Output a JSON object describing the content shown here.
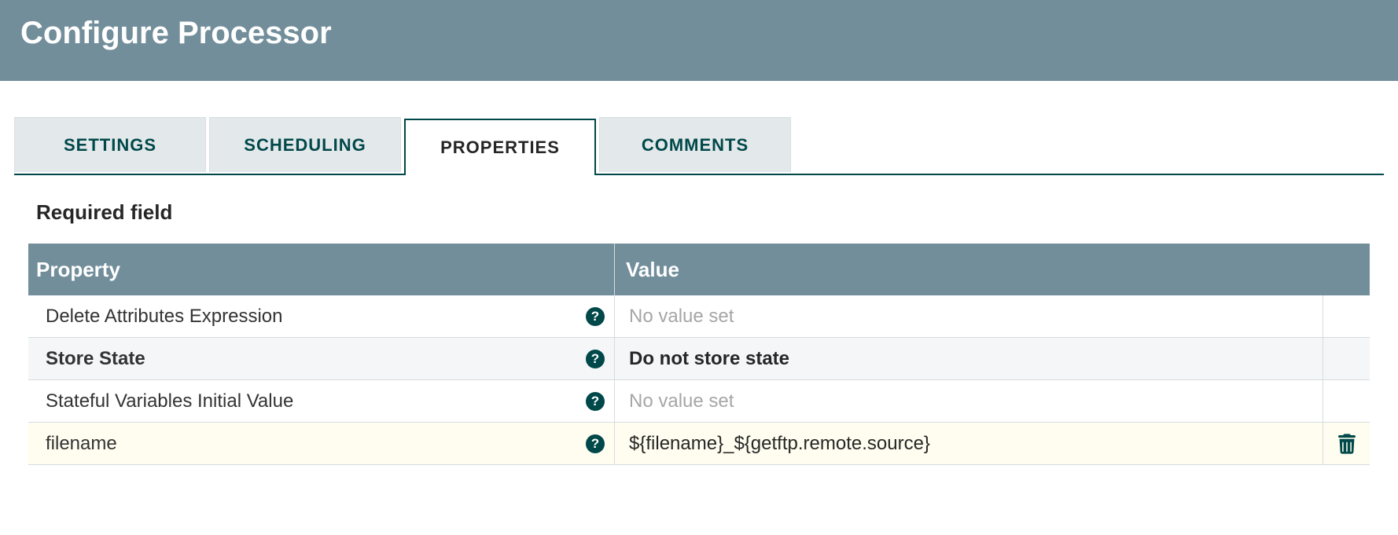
{
  "header": {
    "title": "Configure Processor"
  },
  "tabs": [
    {
      "label": "SETTINGS",
      "active": false
    },
    {
      "label": "SCHEDULING",
      "active": false
    },
    {
      "label": "PROPERTIES",
      "active": true
    },
    {
      "label": "COMMENTS",
      "active": false
    }
  ],
  "required_label": "Required field",
  "table": {
    "headers": {
      "property": "Property",
      "value": "Value"
    },
    "rows": [
      {
        "property": "Delete Attributes Expression",
        "bold": false,
        "value": "No value set",
        "valueBold": false,
        "unset": true,
        "alt": false,
        "deletable": false
      },
      {
        "property": "Store State",
        "bold": true,
        "value": "Do not store state",
        "valueBold": true,
        "unset": false,
        "alt": true,
        "deletable": false
      },
      {
        "property": "Stateful Variables Initial Value",
        "bold": false,
        "value": "No value set",
        "valueBold": false,
        "unset": true,
        "alt": false,
        "deletable": false
      },
      {
        "property": "filename",
        "bold": false,
        "value": "${filename}_${getftp.remote.source}",
        "valueBold": false,
        "unset": false,
        "alt": false,
        "highlight": true,
        "deletable": true
      }
    ]
  }
}
